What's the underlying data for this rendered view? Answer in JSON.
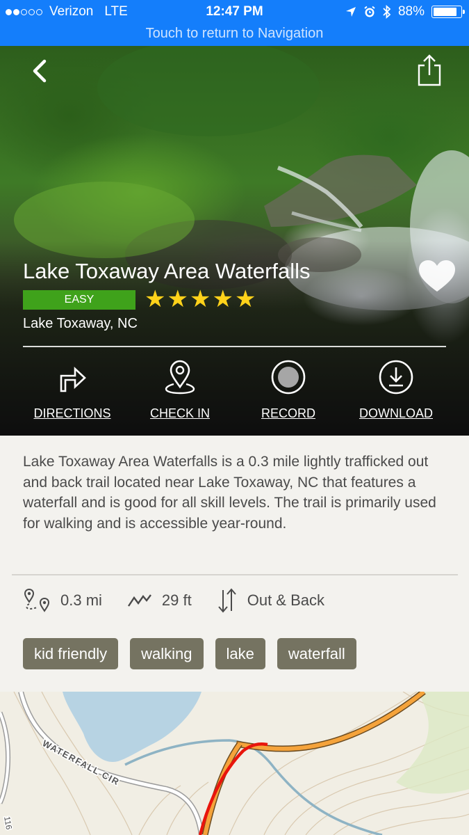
{
  "status_bar": {
    "carrier": "Verizon",
    "network": "LTE",
    "time": "12:47 PM",
    "battery": "88%",
    "battery_level": 0.88,
    "signal_dots_filled": 2,
    "signal_dots_total": 5
  },
  "nav_banner": {
    "text": "Touch to return to Navigation"
  },
  "header": {
    "back_icon": "chevron-left-icon",
    "share_icon": "share-icon"
  },
  "trail": {
    "name": "Lake Toxaway Area Waterfalls",
    "difficulty": "EASY",
    "rating": 5,
    "rating_max": 5,
    "location": "Lake Toxaway, NC",
    "favorite_icon": "heart-icon",
    "colors": {
      "difficulty_badge": "#3fa21b",
      "stars": "#ffd21a",
      "banner": "#147efb",
      "tag": "#757361"
    }
  },
  "actions": [
    {
      "label": "DIRECTIONS",
      "icon": "turn-right-arrow-icon"
    },
    {
      "label": "CHECK IN",
      "icon": "map-pin-icon"
    },
    {
      "label": "RECORD",
      "icon": "record-icon"
    },
    {
      "label": "DOWNLOAD",
      "icon": "download-icon"
    }
  ],
  "description": "Lake Toxaway Area Waterfalls is a 0.3 mile lightly trafficked out and back trail located near Lake Toxaway, NC that features a waterfall and is good for all skill levels. The trail is primarily used for walking and is accessible year-round.",
  "stats": {
    "distance": "0.3 mi",
    "elevation": "29 ft",
    "route_type": "Out & Back"
  },
  "tags": [
    "kid friendly",
    "walking",
    "lake",
    "waterfall"
  ],
  "map": {
    "road_label": "WATERFALL CIR",
    "edge_label": "116"
  }
}
